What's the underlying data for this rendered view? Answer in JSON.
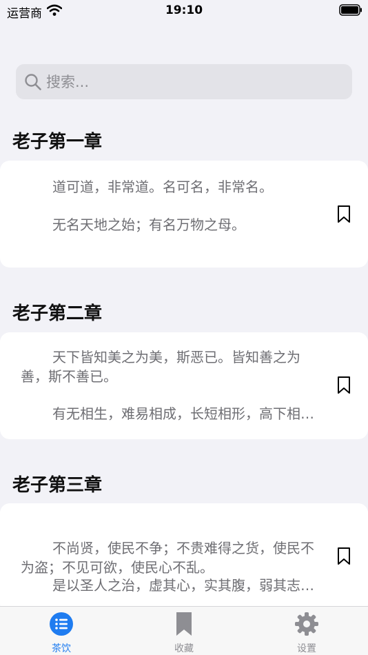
{
  "status_bar": {
    "carrier": "运营商",
    "time": "19:10"
  },
  "search": {
    "placeholder": "搜索..."
  },
  "chapters": [
    {
      "title": "老子第一章",
      "paragraphs": [
        "道可道，非常道。名可名，非常名。",
        "无名天地之始；有名万物之母。"
      ]
    },
    {
      "title": "老子第二章",
      "paragraphs": [
        "天下皆知美之为美，斯恶已。皆知善之为善，斯不善已。",
        "有无相生，难易相成，长短相形，高下相倾，音声相和，前后相随。"
      ]
    },
    {
      "title": "老子第三章",
      "paragraphs": [
        "不尚贤，使民不争；不贵难得之货，使民不为盗；不见可欲，使民心不乱。",
        "是以圣人之治，虚其心，实其腹，弱其志，强其骨。"
      ]
    }
  ],
  "tabs": [
    {
      "label": "茶饮",
      "icon": "list-icon",
      "active": true
    },
    {
      "label": "收藏",
      "icon": "bookmark-icon",
      "active": false
    },
    {
      "label": "设置",
      "icon": "gear-icon",
      "active": false
    }
  ],
  "colors": {
    "accent": "#1f7cf0",
    "inactive": "#8e8e93",
    "background": "#f2f2f7"
  }
}
